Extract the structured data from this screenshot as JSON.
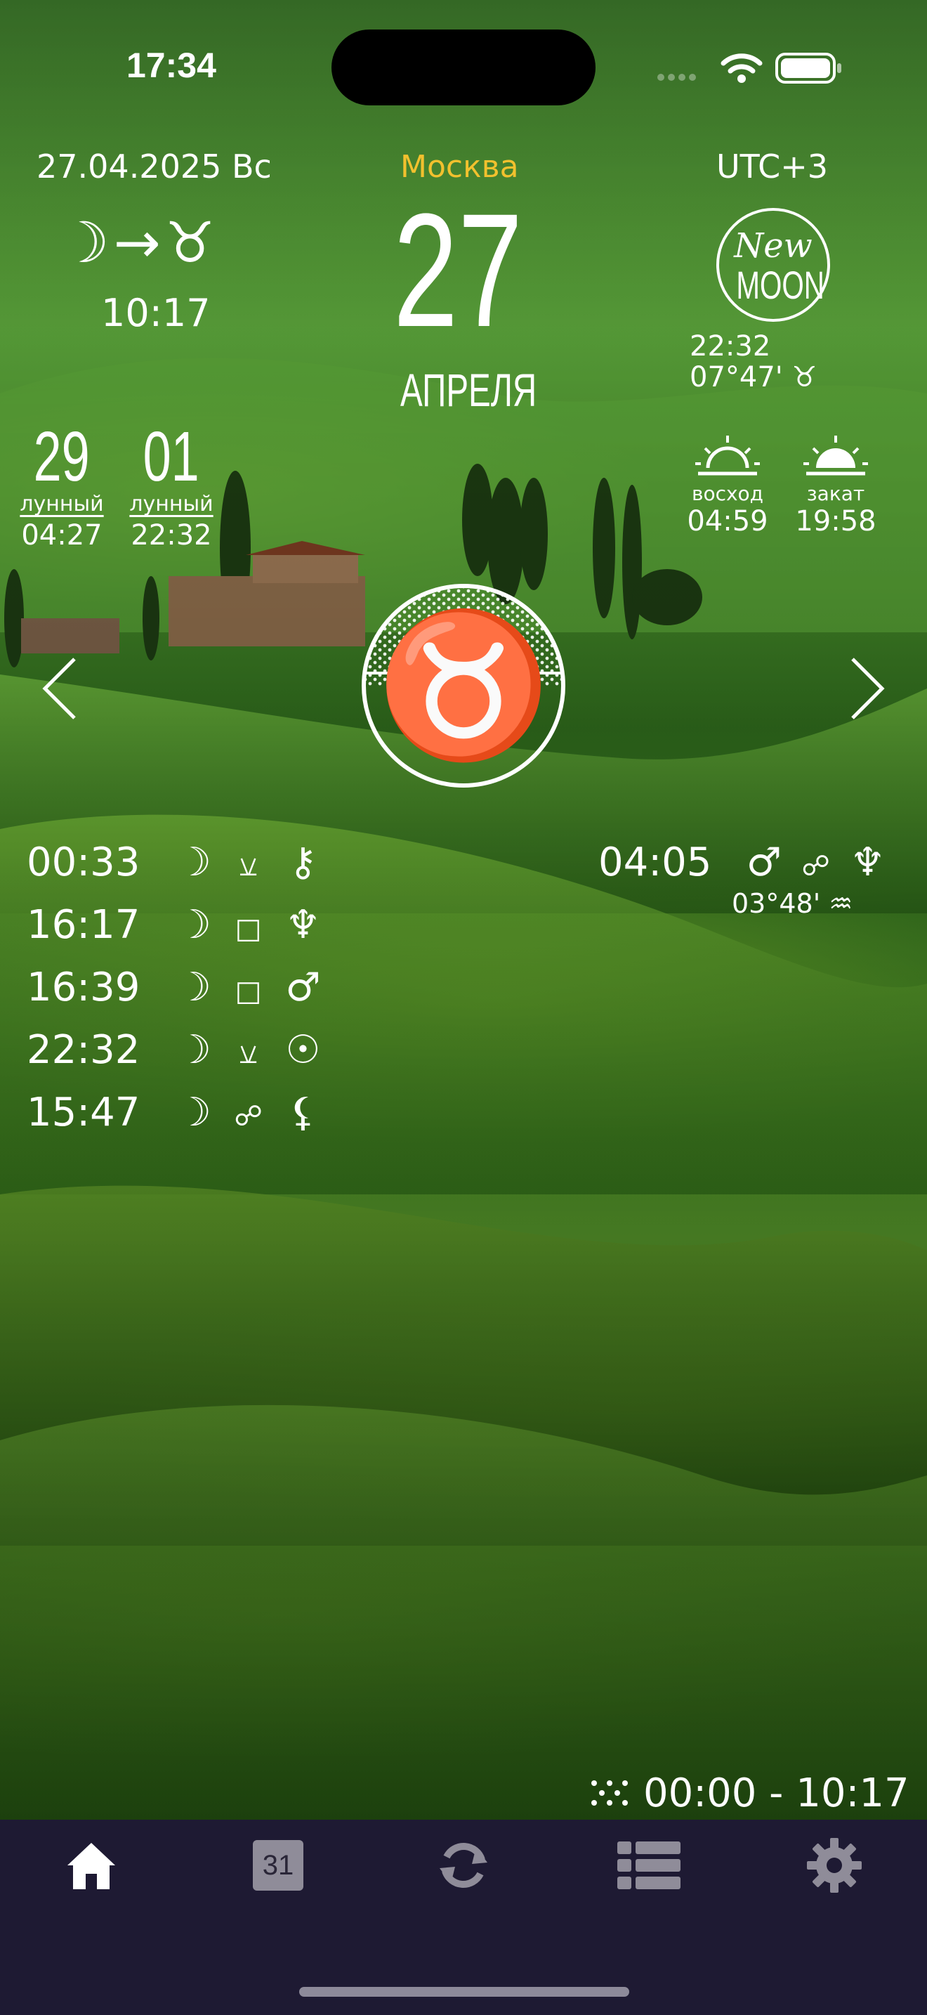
{
  "status_bar": {
    "time": "17:34"
  },
  "header": {
    "date": "27.04.2025 Вс",
    "moon_ingress": {
      "from_glyph": "☽",
      "arrow": "→",
      "to_glyph": "♉",
      "time": "10:17"
    },
    "city": "Москва",
    "day": "27",
    "month": "АПРЕЛЯ",
    "timezone": "UTC+3",
    "new_moon": {
      "line1": "New",
      "line2": "MOON",
      "time": "22:32",
      "position": "07°47' ♉"
    }
  },
  "lunar_days": [
    {
      "number": "29",
      "label": "лунный",
      "time": "04:27"
    },
    {
      "number": "01",
      "label": "лунный",
      "time": "22:32"
    }
  ],
  "sun": {
    "sunrise": {
      "label": "восход",
      "time": "04:59"
    },
    "sunset": {
      "label": "закат",
      "time": "19:58"
    }
  },
  "zodiac": {
    "glyph": "♉",
    "prev_icon": "chevron-left-icon",
    "next_icon": "chevron-right-icon"
  },
  "aspects": [
    {
      "time": "00:33",
      "planet1": "☽",
      "aspect": "⚺",
      "planet2": "⚷"
    },
    {
      "time": "16:17",
      "planet1": "☽",
      "aspect": "□",
      "planet2": "♆"
    },
    {
      "time": "16:39",
      "planet1": "☽",
      "aspect": "□",
      "planet2": "♂"
    },
    {
      "time": "22:32",
      "planet1": "☽",
      "aspect": "⚺",
      "planet2": "☉"
    },
    {
      "time": "15:47",
      "planet1": "☽",
      "aspect": "☍",
      "planet2": "⚸"
    }
  ],
  "other_aspect": {
    "time": "04:05",
    "planet1": "♂",
    "aspect": "☍",
    "planet2": "♆",
    "position": "03°48' ♒"
  },
  "void_course": {
    "icon": "dots-icon",
    "range": "00:00 - 10:17"
  },
  "tabs": [
    {
      "name": "home",
      "icon": "home-icon"
    },
    {
      "name": "calendar",
      "icon": "calendar-icon",
      "label": "31"
    },
    {
      "name": "sync",
      "icon": "sync-icon"
    },
    {
      "name": "list",
      "icon": "list-icon"
    },
    {
      "name": "settings",
      "icon": "gear-icon"
    }
  ],
  "colors": {
    "accent": "#f2c12e",
    "tabbar": "#1e1a33",
    "tab_active": "#ffffff",
    "tab_inactive": "#8f8c99"
  }
}
